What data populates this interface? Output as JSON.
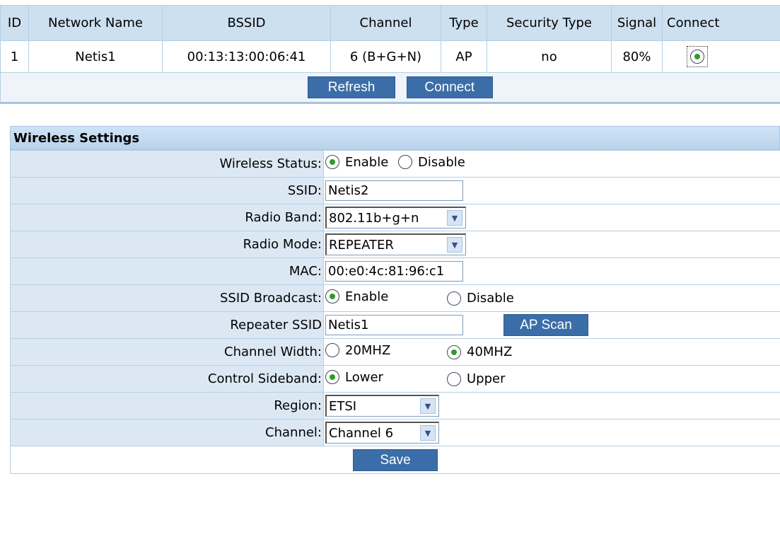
{
  "scan_table": {
    "headers": [
      "ID",
      "Network Name",
      "BSSID",
      "Channel",
      "Type",
      "Security Type",
      "Signal",
      "Connect"
    ],
    "rows": [
      {
        "id": "1",
        "name": "Netis1",
        "bssid": "00:13:13:00:06:41",
        "channel": "6 (B+G+N)",
        "type": "AP",
        "security": "no",
        "signal": "80%"
      }
    ],
    "refresh_label": "Refresh",
    "connect_label": "Connect"
  },
  "wireless": {
    "title": "Wireless Settings",
    "wireless_status": {
      "label": "Wireless Status:",
      "enable": "Enable",
      "disable": "Disable",
      "selected": "Enable"
    },
    "ssid": {
      "label": "SSID:",
      "value": "Netis2"
    },
    "radio_band": {
      "label": "Radio Band:",
      "value": "802.11b+g+n"
    },
    "radio_mode": {
      "label": "Radio Mode:",
      "value": "REPEATER"
    },
    "mac": {
      "label": "MAC:",
      "value": "00:e0:4c:81:96:c1"
    },
    "ssid_broadcast": {
      "label": "SSID Broadcast:",
      "enable": "Enable",
      "disable": "Disable",
      "selected": "Enable"
    },
    "repeater_ssid": {
      "label": "Repeater SSID",
      "value": "Netis1",
      "scan_label": "AP Scan"
    },
    "channel_width": {
      "label": "Channel Width:",
      "opt1": "20MHZ",
      "opt2": "40MHZ",
      "selected": "40MHZ"
    },
    "control_sideband": {
      "label": "Control Sideband:",
      "opt1": "Lower",
      "opt2": "Upper",
      "selected": "Lower"
    },
    "region": {
      "label": "Region:",
      "value": "ETSI"
    },
    "channel": {
      "label": "Channel:",
      "value": "Channel 6"
    },
    "save_label": "Save"
  },
  "colors": {
    "button_bg": "#3b6ea8",
    "header_bg": "#cde0f0",
    "label_bg": "#dbe8f4",
    "radio_dot": "#2f9a2f"
  }
}
